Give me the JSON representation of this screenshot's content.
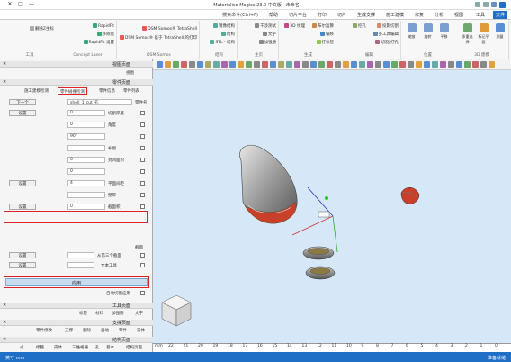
{
  "window": {
    "title": "Materialise Magics 23.0 中文版 - 未命名",
    "minimize": "—",
    "maximize": "□",
    "close": "✕"
  },
  "tabs": [
    "文件",
    "工具",
    "视图",
    "分析",
    "修复",
    "施工建模",
    "生成支撑",
    "切片",
    "打印",
    "切片平台",
    "帮助",
    "搜索命令(Ctrl+F)"
  ],
  "ribbon": {
    "groups": [
      {
        "label": "3D 建模",
        "items": [
          "测量",
          "标记平面",
          "多重选择"
        ]
      },
      {
        "label": "位置",
        "items": [
          "平移",
          "旋转",
          "缩放"
        ]
      },
      {
        "label": "编辑",
        "items": [
          "投影切割",
          "多工具编辑",
          "切割/打孔",
          "挖孔"
        ]
      },
      {
        "label": "生成",
        "items": [
          "布尔运算",
          "偏移",
          "打标签",
          "3D 纹理"
        ]
      },
      {
        "label": "主页",
        "items": [
          "干涉测试",
          "文字",
          "加强筋"
        ]
      },
      {
        "label": "结构",
        "items": [
          "镜像结构",
          "结构",
          "STL - 结构"
        ]
      },
      {
        "label": "DSM Somos",
        "items": [
          "DSM Somos® TetraShell",
          "DSM Somos® 基于 TetraShell 的打印"
        ]
      },
      {
        "label": "Concept Laser",
        "items": [
          "RapidFit",
          "移除量",
          "RapidFit 设置"
        ]
      },
      {
        "label": "工具",
        "items": [
          "删除Z坐标"
        ]
      }
    ]
  },
  "status": {
    "left": "准备就绪",
    "right": "英寸 mm"
  },
  "ruler": {
    "unit": "mm",
    "ticks": [
      "0",
      "1",
      "2",
      "3",
      "4",
      "5",
      "6",
      "7",
      "8",
      "9",
      "10",
      "11",
      "12",
      "13",
      "14",
      "15",
      "16",
      "17",
      "18",
      "19",
      "20",
      "21",
      "22"
    ]
  },
  "leftpanel": {
    "view_pages_header": "视图页面",
    "view_tab": "视图",
    "part_pages_header": "零件页面",
    "part_tabs": [
      "零件列表",
      "零件信息",
      "零件碰撞检测",
      "施工建模检测"
    ],
    "part_label": "零件名",
    "part_value": "shell_1_cut_孔",
    "next_btn": "下一个",
    "rows": [
      {
        "label": "切割厚度",
        "value": "0",
        "btn": "设置"
      },
      {
        "label": "角度",
        "value": "0",
        "btn": ""
      },
      {
        "label": "",
        "value": "90°",
        "btn": ""
      },
      {
        "label": "补偿",
        "value": "",
        "btn": ""
      },
      {
        "label": "封闭面积",
        "value": "0",
        "btn": ""
      },
      {
        "label": "",
        "value": "0",
        "btn": ""
      },
      {
        "label": "平面间距",
        "value": "4",
        "btn": "设置"
      },
      {
        "label": "壁厚",
        "value": "",
        "btn": ""
      },
      {
        "label": "截面积",
        "value": "0",
        "btn": "设置"
      }
    ],
    "section_label": "截面",
    "sub_rows": [
      {
        "label": "从第三个截面",
        "btn": "设置"
      },
      {
        "label": "文本工具",
        "btn": "设置"
      }
    ],
    "apply_btn": "应用",
    "auto_label": "自动切割应用",
    "tools_header": "工具页面",
    "tools_tabs": [
      "文字",
      "加强筋",
      "材料",
      "标签"
    ],
    "support_header": "支撑页面",
    "support_tabs": [
      "实体",
      "零件",
      "自动",
      "删除",
      "支撑",
      "零件修改"
    ],
    "struct_header": "结构页面",
    "struct_tabs": [
      "结构页面",
      "基本",
      "孔",
      "三维格栅",
      "壳体",
      "修整",
      "点"
    ]
  }
}
